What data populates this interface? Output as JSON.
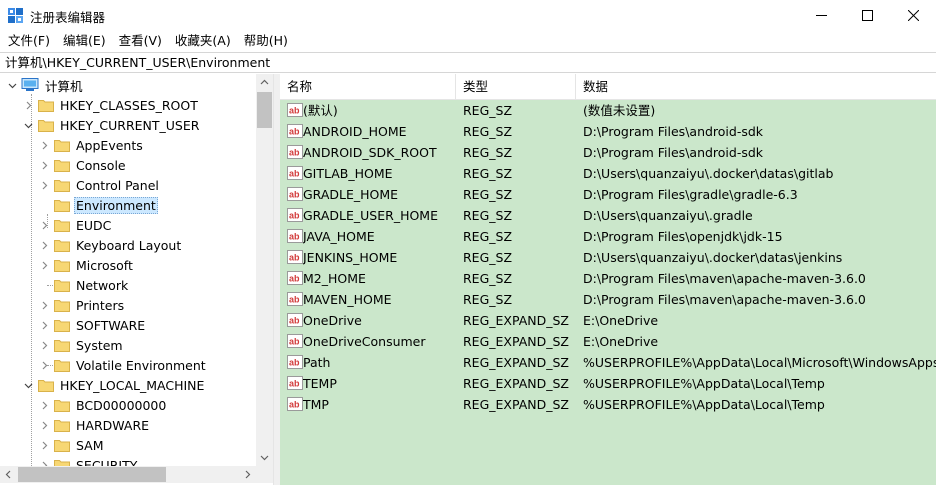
{
  "window": {
    "title": "注册表编辑器",
    "minimize_glyph": "—",
    "maximize_glyph": "☐",
    "close_glyph": "✕"
  },
  "menu": [
    "文件(F)",
    "编辑(E)",
    "查看(V)",
    "收藏夹(A)",
    "帮助(H)"
  ],
  "address": "计算机\\HKEY_CURRENT_USER\\Environment",
  "tree": {
    "root": "计算机",
    "items": [
      {
        "label": "HKEY_CLASSES_ROOT",
        "level": 1,
        "expanded": false
      },
      {
        "label": "HKEY_CURRENT_USER",
        "level": 1,
        "expanded": true
      },
      {
        "label": "AppEvents",
        "level": 2,
        "expanded": false
      },
      {
        "label": "Console",
        "level": 2,
        "expanded": false
      },
      {
        "label": "Control Panel",
        "level": 2,
        "expanded": false
      },
      {
        "label": "Environment",
        "level": 2,
        "expanded": null,
        "selected": true
      },
      {
        "label": "EUDC",
        "level": 2,
        "expanded": false
      },
      {
        "label": "Keyboard Layout",
        "level": 2,
        "expanded": false
      },
      {
        "label": "Microsoft",
        "level": 2,
        "expanded": false
      },
      {
        "label": "Network",
        "level": 2,
        "expanded": null
      },
      {
        "label": "Printers",
        "level": 2,
        "expanded": false
      },
      {
        "label": "SOFTWARE",
        "level": 2,
        "expanded": false
      },
      {
        "label": "System",
        "level": 2,
        "expanded": false
      },
      {
        "label": "Volatile Environment",
        "level": 2,
        "expanded": false
      },
      {
        "label": "HKEY_LOCAL_MACHINE",
        "level": 1,
        "expanded": true
      },
      {
        "label": "BCD00000000",
        "level": 2,
        "expanded": false
      },
      {
        "label": "HARDWARE",
        "level": 2,
        "expanded": false
      },
      {
        "label": "SAM",
        "level": 2,
        "expanded": false
      },
      {
        "label": "SECURITY",
        "level": 2,
        "expanded": false
      }
    ]
  },
  "list": {
    "columns": [
      "名称",
      "类型",
      "数据"
    ],
    "rows": [
      {
        "name": "(默认)",
        "type": "REG_SZ",
        "data": "(数值未设置)"
      },
      {
        "name": "ANDROID_HOME",
        "type": "REG_SZ",
        "data": "D:\\Program Files\\android-sdk"
      },
      {
        "name": "ANDROID_SDK_ROOT",
        "type": "REG_SZ",
        "data": "D:\\Program Files\\android-sdk"
      },
      {
        "name": "GITLAB_HOME",
        "type": "REG_SZ",
        "data": "D:\\Users\\quanzaiyu\\.docker\\datas\\gitlab"
      },
      {
        "name": "GRADLE_HOME",
        "type": "REG_SZ",
        "data": "D:\\Program Files\\gradle\\gradle-6.3"
      },
      {
        "name": "GRADLE_USER_HOME",
        "type": "REG_SZ",
        "data": "D:\\Users\\quanzaiyu\\.gradle"
      },
      {
        "name": "JAVA_HOME",
        "type": "REG_SZ",
        "data": "D:\\Program Files\\openjdk\\jdk-15"
      },
      {
        "name": "JENKINS_HOME",
        "type": "REG_SZ",
        "data": "D:\\Users\\quanzaiyu\\.docker\\datas\\jenkins"
      },
      {
        "name": "M2_HOME",
        "type": "REG_SZ",
        "data": "D:\\Program Files\\maven\\apache-maven-3.6.0"
      },
      {
        "name": "MAVEN_HOME",
        "type": "REG_SZ",
        "data": "D:\\Program Files\\maven\\apache-maven-3.6.0"
      },
      {
        "name": "OneDrive",
        "type": "REG_EXPAND_SZ",
        "data": "E:\\OneDrive"
      },
      {
        "name": "OneDriveConsumer",
        "type": "REG_EXPAND_SZ",
        "data": "E:\\OneDrive"
      },
      {
        "name": "Path",
        "type": "REG_EXPAND_SZ",
        "data": "%USERPROFILE%\\AppData\\Local\\Microsoft\\WindowsApps;C"
      },
      {
        "name": "TEMP",
        "type": "REG_EXPAND_SZ",
        "data": "%USERPROFILE%\\AppData\\Local\\Temp"
      },
      {
        "name": "TMP",
        "type": "REG_EXPAND_SZ",
        "data": "%USERPROFILE%\\AppData\\Local\\Temp"
      }
    ]
  },
  "colors": {
    "list_background": "#cbe7cb",
    "selection": "#cce8ff",
    "folder": "#f7d774",
    "value_icon": "#d23a3a"
  },
  "icons": {
    "app": "registry-editor-icon",
    "computer": "computer-icon",
    "folder": "folder-icon",
    "value": "string-value-icon"
  }
}
